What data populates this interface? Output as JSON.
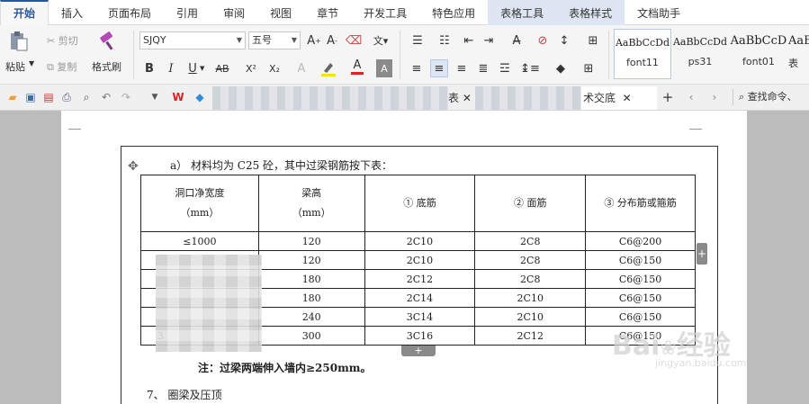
{
  "menu_tabs": [
    "开始",
    "插入",
    "页面布局",
    "引用",
    "审阅",
    "视图",
    "章节",
    "开发工具",
    "特色应用",
    "表格工具",
    "表格样式",
    "文档助手"
  ],
  "clipboard": {
    "paste": "粘贴",
    "cut": "剪切",
    "copy": "复制",
    "format_painter": "格式刷"
  },
  "font": {
    "name": "SJQY",
    "size": "五号",
    "bold": "B",
    "italic": "I",
    "underline": "U",
    "strike": "AB",
    "superscript": "X²",
    "subscript": "X₂",
    "font_color_letter": "A",
    "highlight_letter": "A"
  },
  "styles": [
    {
      "preview": "AaBbCcDd",
      "name": "font11"
    },
    {
      "preview": "AaBbCcDd",
      "name": "ps31"
    },
    {
      "preview": "AaBbCcD",
      "name": "font01"
    },
    {
      "preview": "AaBl",
      "name": "表"
    }
  ],
  "quick_bar": {
    "tab_suffix": "表",
    "active_tab_suffix": "术交底",
    "search": "查找命令、"
  },
  "document": {
    "line_a": "a）  材料均为 C25 砼，其中过梁钢筋按下表：",
    "table": {
      "headers": [
        "洞口净宽度\n（mm）",
        "梁高\n（mm）",
        "① 底筋",
        "② 面筋",
        "③ 分布筋或箍筋"
      ],
      "rows": [
        [
          "≤1000",
          "120",
          "2C10",
          "2C8",
          "C6@200"
        ],
        [
          "",
          "120",
          "2C10",
          "2C8",
          "C6@150"
        ],
        [
          "",
          "180",
          "2C12",
          "2C8",
          "C6@150"
        ],
        [
          "",
          "180",
          "2C14",
          "2C10",
          "C6@150"
        ],
        [
          "",
          "240",
          "3C14",
          "2C10",
          "C6@150"
        ],
        [
          "3",
          "300",
          "3C16",
          "2C12",
          "C6@150"
        ]
      ]
    },
    "note": "注：过梁两端伸入墙内≥250mm。",
    "section": "7、  圈梁及压顶"
  },
  "watermark": {
    "brand": "Bai",
    "brand2": "经验",
    "url": "jingyan.baidu.com"
  },
  "colors": {
    "accent": "#2b579a",
    "font_color": "#d22",
    "highlight": "#f5e400"
  }
}
